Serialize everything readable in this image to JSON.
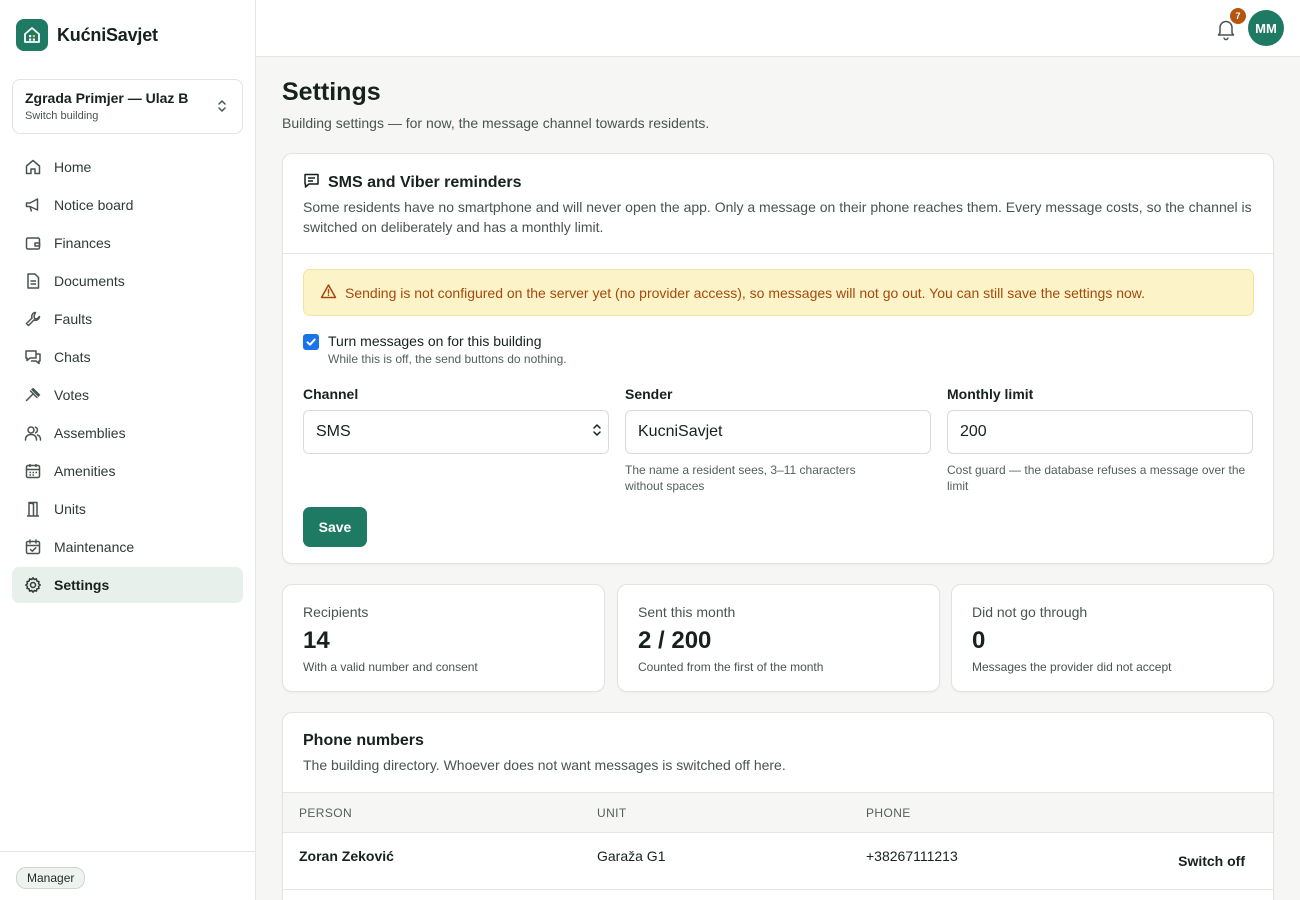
{
  "app": {
    "name": "KućniSavjet"
  },
  "building_switcher": {
    "name": "Zgrada Primjer — Ulaz B",
    "subtitle": "Switch building"
  },
  "sidebar": {
    "items": [
      {
        "label": "Home",
        "icon": "home-icon"
      },
      {
        "label": "Notice board",
        "icon": "megaphone-icon"
      },
      {
        "label": "Finances",
        "icon": "wallet-icon"
      },
      {
        "label": "Documents",
        "icon": "document-icon"
      },
      {
        "label": "Faults",
        "icon": "wrench-icon"
      },
      {
        "label": "Chats",
        "icon": "chat-icon"
      },
      {
        "label": "Votes",
        "icon": "gavel-icon"
      },
      {
        "label": "Assemblies",
        "icon": "users-icon"
      },
      {
        "label": "Amenities",
        "icon": "calendar-icon"
      },
      {
        "label": "Units",
        "icon": "door-icon"
      },
      {
        "label": "Maintenance",
        "icon": "calendar-check-icon"
      },
      {
        "label": "Settings",
        "icon": "gear-icon",
        "active": true
      }
    ],
    "role": "Manager"
  },
  "topbar": {
    "notifications_count": "7",
    "avatar_initials": "MM"
  },
  "page": {
    "title": "Settings",
    "subtitle": "Building settings — for now, the message channel towards residents."
  },
  "sms_card": {
    "title": "SMS and Viber reminders",
    "description": "Some residents have no smartphone and will never open the app. Only a message on their phone reaches them. Every message costs, so the channel is switched on deliberately and has a monthly limit.",
    "warning": "Sending is not configured on the server yet (no provider access), so messages will not go out. You can still save the settings now.",
    "toggle": {
      "label": "Turn messages on for this building",
      "help": "While this is off, the send buttons do nothing.",
      "checked": true
    },
    "channel": {
      "label": "Channel",
      "value": "SMS"
    },
    "sender": {
      "label": "Sender",
      "value": "KucniSavjet",
      "help": "The name a resident sees, 3–11 characters without spaces"
    },
    "limit": {
      "label": "Monthly limit",
      "value": "200",
      "help": "Cost guard — the database refuses a message over the limit"
    },
    "save_label": "Save"
  },
  "stats": [
    {
      "label": "Recipients",
      "value": "14",
      "help": "With a valid number and consent"
    },
    {
      "label": "Sent this month",
      "value": "2 / 200",
      "help": "Counted from the first of the month"
    },
    {
      "label": "Did not go through",
      "value": "0",
      "help": "Messages the provider did not accept"
    }
  ],
  "phones": {
    "title": "Phone numbers",
    "description": "The building directory. Whoever does not want messages is switched off here.",
    "columns": [
      "PERSON",
      "UNIT",
      "PHONE"
    ],
    "rows": [
      {
        "person": "Zoran Zeković",
        "unit": "Garaža G1",
        "phone": "+38267111213",
        "action": "Switch off"
      }
    ]
  },
  "colors": {
    "brand": "#1f7a63",
    "warning_bg": "#fdf3c8",
    "warning_text": "#a44a0c",
    "badge": "#b4560f"
  }
}
